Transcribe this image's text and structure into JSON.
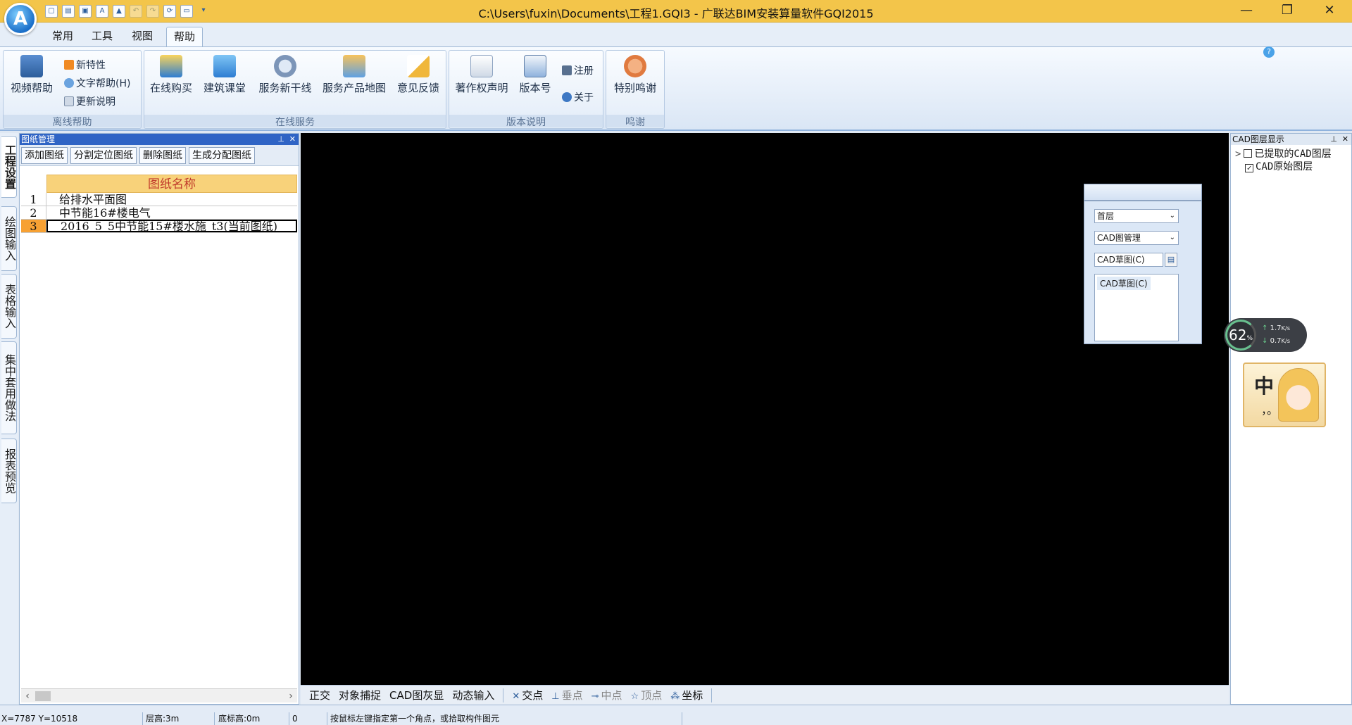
{
  "titlebar": {
    "logo_letter": "A",
    "title": "C:\\Users\\fuxin\\Documents\\工程1.GQI3 - 广联达BIM安装算量软件GQI2015",
    "minimize": "—",
    "restore": "❐",
    "close": "✕"
  },
  "tabs": [
    "常用",
    "工具",
    "视图",
    "帮助"
  ],
  "ribbon": {
    "groups": {
      "offline": {
        "label": "离线帮助",
        "video_help": "视频帮助",
        "new_features": "新特性",
        "text_help": "文字帮助(H)",
        "update_notes": "更新说明"
      },
      "online": {
        "label": "在线服务",
        "buy_online": "在线购买",
        "building_class": "建筑课堂",
        "service_hotline": "服务新干线",
        "service_map": "服务产品地图",
        "feedback": "意见反馈"
      },
      "version": {
        "label": "版本说明",
        "copyright": "著作权声明",
        "version_no": "版本号",
        "register": "注册",
        "about": "关于"
      },
      "thanks": {
        "label": "鸣谢",
        "special_thanks": "特别鸣谢"
      }
    }
  },
  "side_tabs": [
    "工程设置",
    "绘图输入",
    "表格输入",
    "集中套用做法",
    "报表预览"
  ],
  "drawing_panel": {
    "title": "图纸管理",
    "buttons": [
      "添加图纸",
      "分割定位图纸",
      "删除图纸",
      "生成分配图纸"
    ],
    "column_header": "图纸名称",
    "rows": [
      {
        "num": "1",
        "name": "给排水平面图"
      },
      {
        "num": "2",
        "name": "中节能16#楼电气"
      },
      {
        "num": "3",
        "name": "2016_5_5中节能15#楼水施_t3(当前图纸)"
      }
    ]
  },
  "canvas_status": {
    "toggles": [
      "正交",
      "对象捕捉",
      "CAD图灰显",
      "动态输入"
    ],
    "snaps": [
      {
        "icon": "✕",
        "label": "交点",
        "enabled": true
      },
      {
        "icon": "⊥",
        "label": "垂点",
        "enabled": false
      },
      {
        "icon": "⊸",
        "label": "中点",
        "enabled": false
      },
      {
        "icon": "☆",
        "label": "顶点",
        "enabled": false
      },
      {
        "icon": "⁂",
        "label": "坐标",
        "enabled": true
      }
    ]
  },
  "float_panel": {
    "floor": "首层",
    "mode": "CAD图管理",
    "drawing": "CAD草图(C)",
    "list_item": "CAD草图(C)"
  },
  "layer_panel": {
    "title": "CAD图层显示",
    "nodes": [
      {
        "label": "已提取的CAD图层",
        "checked": false,
        "expander": ">"
      },
      {
        "label": "CAD原始图层",
        "checked": true,
        "expander": ""
      }
    ]
  },
  "speed_widget": {
    "percent": "62",
    "unit": "%",
    "up": "1.7",
    "down": "0.7",
    "rate_unit": "K/s"
  },
  "ime": {
    "char": "中",
    "punct": "，。"
  },
  "status_bar": {
    "coords": "X=7787 Y=10518",
    "floor_height": "层高:3m",
    "base_height": "底标高:0m",
    "value": "0",
    "hint": "按鼠标左键指定第一个角点，或拾取构件图元"
  },
  "colors": {
    "titlebar": "#f3c54a",
    "panel_header": "#2f64c5",
    "grid_header": "#f8d27a",
    "selected_row": "#f7a133",
    "canvas": "#000000"
  }
}
